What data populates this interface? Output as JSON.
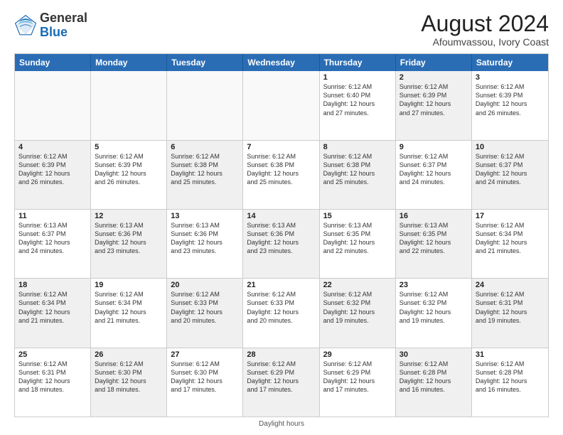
{
  "logo": {
    "general": "General",
    "blue": "Blue"
  },
  "title": "August 2024",
  "subtitle": "Afoumvassou, Ivory Coast",
  "days": [
    "Sunday",
    "Monday",
    "Tuesday",
    "Wednesday",
    "Thursday",
    "Friday",
    "Saturday"
  ],
  "footer": "Daylight hours",
  "weeks": [
    [
      {
        "day": "",
        "info": "",
        "shaded": false,
        "empty": true
      },
      {
        "day": "",
        "info": "",
        "shaded": false,
        "empty": true
      },
      {
        "day": "",
        "info": "",
        "shaded": false,
        "empty": true
      },
      {
        "day": "",
        "info": "",
        "shaded": false,
        "empty": true
      },
      {
        "day": "1",
        "info": "Sunrise: 6:12 AM\nSunset: 6:40 PM\nDaylight: 12 hours\nand 27 minutes.",
        "shaded": false,
        "empty": false
      },
      {
        "day": "2",
        "info": "Sunrise: 6:12 AM\nSunset: 6:39 PM\nDaylight: 12 hours\nand 27 minutes.",
        "shaded": true,
        "empty": false
      },
      {
        "day": "3",
        "info": "Sunrise: 6:12 AM\nSunset: 6:39 PM\nDaylight: 12 hours\nand 26 minutes.",
        "shaded": false,
        "empty": false
      }
    ],
    [
      {
        "day": "4",
        "info": "Sunrise: 6:12 AM\nSunset: 6:39 PM\nDaylight: 12 hours\nand 26 minutes.",
        "shaded": true,
        "empty": false
      },
      {
        "day": "5",
        "info": "Sunrise: 6:12 AM\nSunset: 6:39 PM\nDaylight: 12 hours\nand 26 minutes.",
        "shaded": false,
        "empty": false
      },
      {
        "day": "6",
        "info": "Sunrise: 6:12 AM\nSunset: 6:38 PM\nDaylight: 12 hours\nand 25 minutes.",
        "shaded": true,
        "empty": false
      },
      {
        "day": "7",
        "info": "Sunrise: 6:12 AM\nSunset: 6:38 PM\nDaylight: 12 hours\nand 25 minutes.",
        "shaded": false,
        "empty": false
      },
      {
        "day": "8",
        "info": "Sunrise: 6:12 AM\nSunset: 6:38 PM\nDaylight: 12 hours\nand 25 minutes.",
        "shaded": true,
        "empty": false
      },
      {
        "day": "9",
        "info": "Sunrise: 6:12 AM\nSunset: 6:37 PM\nDaylight: 12 hours\nand 24 minutes.",
        "shaded": false,
        "empty": false
      },
      {
        "day": "10",
        "info": "Sunrise: 6:12 AM\nSunset: 6:37 PM\nDaylight: 12 hours\nand 24 minutes.",
        "shaded": true,
        "empty": false
      }
    ],
    [
      {
        "day": "11",
        "info": "Sunrise: 6:13 AM\nSunset: 6:37 PM\nDaylight: 12 hours\nand 24 minutes.",
        "shaded": false,
        "empty": false
      },
      {
        "day": "12",
        "info": "Sunrise: 6:13 AM\nSunset: 6:36 PM\nDaylight: 12 hours\nand 23 minutes.",
        "shaded": true,
        "empty": false
      },
      {
        "day": "13",
        "info": "Sunrise: 6:13 AM\nSunset: 6:36 PM\nDaylight: 12 hours\nand 23 minutes.",
        "shaded": false,
        "empty": false
      },
      {
        "day": "14",
        "info": "Sunrise: 6:13 AM\nSunset: 6:36 PM\nDaylight: 12 hours\nand 23 minutes.",
        "shaded": true,
        "empty": false
      },
      {
        "day": "15",
        "info": "Sunrise: 6:13 AM\nSunset: 6:35 PM\nDaylight: 12 hours\nand 22 minutes.",
        "shaded": false,
        "empty": false
      },
      {
        "day": "16",
        "info": "Sunrise: 6:13 AM\nSunset: 6:35 PM\nDaylight: 12 hours\nand 22 minutes.",
        "shaded": true,
        "empty": false
      },
      {
        "day": "17",
        "info": "Sunrise: 6:12 AM\nSunset: 6:34 PM\nDaylight: 12 hours\nand 21 minutes.",
        "shaded": false,
        "empty": false
      }
    ],
    [
      {
        "day": "18",
        "info": "Sunrise: 6:12 AM\nSunset: 6:34 PM\nDaylight: 12 hours\nand 21 minutes.",
        "shaded": true,
        "empty": false
      },
      {
        "day": "19",
        "info": "Sunrise: 6:12 AM\nSunset: 6:34 PM\nDaylight: 12 hours\nand 21 minutes.",
        "shaded": false,
        "empty": false
      },
      {
        "day": "20",
        "info": "Sunrise: 6:12 AM\nSunset: 6:33 PM\nDaylight: 12 hours\nand 20 minutes.",
        "shaded": true,
        "empty": false
      },
      {
        "day": "21",
        "info": "Sunrise: 6:12 AM\nSunset: 6:33 PM\nDaylight: 12 hours\nand 20 minutes.",
        "shaded": false,
        "empty": false
      },
      {
        "day": "22",
        "info": "Sunrise: 6:12 AM\nSunset: 6:32 PM\nDaylight: 12 hours\nand 19 minutes.",
        "shaded": true,
        "empty": false
      },
      {
        "day": "23",
        "info": "Sunrise: 6:12 AM\nSunset: 6:32 PM\nDaylight: 12 hours\nand 19 minutes.",
        "shaded": false,
        "empty": false
      },
      {
        "day": "24",
        "info": "Sunrise: 6:12 AM\nSunset: 6:31 PM\nDaylight: 12 hours\nand 19 minutes.",
        "shaded": true,
        "empty": false
      }
    ],
    [
      {
        "day": "25",
        "info": "Sunrise: 6:12 AM\nSunset: 6:31 PM\nDaylight: 12 hours\nand 18 minutes.",
        "shaded": false,
        "empty": false
      },
      {
        "day": "26",
        "info": "Sunrise: 6:12 AM\nSunset: 6:30 PM\nDaylight: 12 hours\nand 18 minutes.",
        "shaded": true,
        "empty": false
      },
      {
        "day": "27",
        "info": "Sunrise: 6:12 AM\nSunset: 6:30 PM\nDaylight: 12 hours\nand 17 minutes.",
        "shaded": false,
        "empty": false
      },
      {
        "day": "28",
        "info": "Sunrise: 6:12 AM\nSunset: 6:29 PM\nDaylight: 12 hours\nand 17 minutes.",
        "shaded": true,
        "empty": false
      },
      {
        "day": "29",
        "info": "Sunrise: 6:12 AM\nSunset: 6:29 PM\nDaylight: 12 hours\nand 17 minutes.",
        "shaded": false,
        "empty": false
      },
      {
        "day": "30",
        "info": "Sunrise: 6:12 AM\nSunset: 6:28 PM\nDaylight: 12 hours\nand 16 minutes.",
        "shaded": true,
        "empty": false
      },
      {
        "day": "31",
        "info": "Sunrise: 6:12 AM\nSunset: 6:28 PM\nDaylight: 12 hours\nand 16 minutes.",
        "shaded": false,
        "empty": false
      }
    ]
  ]
}
